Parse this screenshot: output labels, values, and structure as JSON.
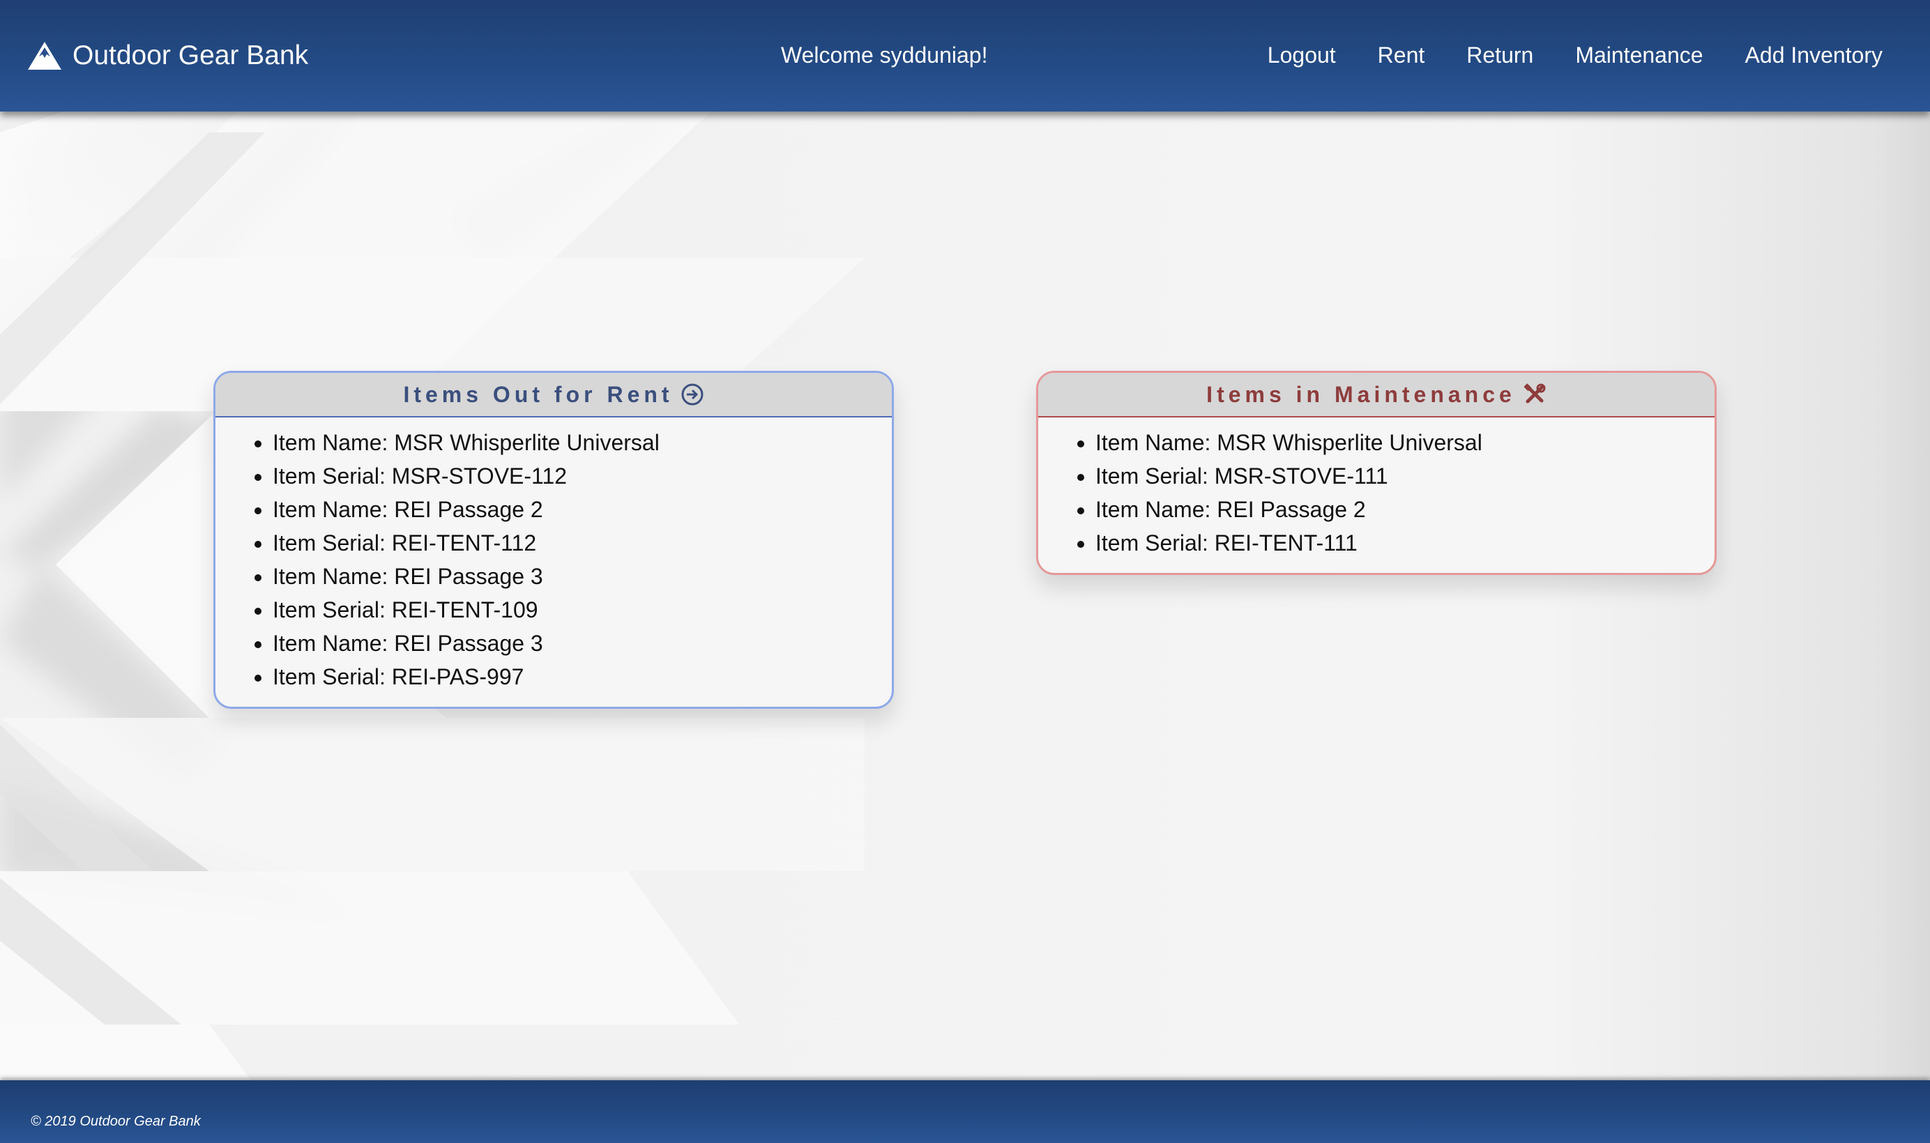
{
  "header": {
    "brand": "Outdoor Gear Bank",
    "brand_icon": "mountain-icon",
    "welcome": "Welcome sydduniap!",
    "nav": [
      "Logout",
      "Rent",
      "Return",
      "Maintenance",
      "Add Inventory"
    ]
  },
  "rent_panel": {
    "title": "Items Out for Rent",
    "icon": "arrow-circle-right-icon",
    "accent": "#8ea8e9",
    "items": [
      "Item Name: MSR Whisperlite Universal",
      "Item Serial: MSR-STOVE-112",
      "Item Name: REI Passage 2",
      "Item Serial: REI-TENT-112",
      "Item Name: REI Passage 3",
      "Item Serial: REI-TENT-109",
      "Item Name: REI Passage 3",
      "Item Serial: REI-PAS-997"
    ]
  },
  "maintenance_panel": {
    "title": "Items in Maintenance",
    "icon": "tools-icon",
    "accent": "#e59898",
    "items": [
      "Item Name: MSR Whisperlite Universal",
      "Item Serial: MSR-STOVE-111",
      "Item Name: REI Passage 2",
      "Item Serial: REI-TENT-111"
    ]
  },
  "footer": {
    "copyright": "© 2019 Outdoor Gear Bank"
  }
}
